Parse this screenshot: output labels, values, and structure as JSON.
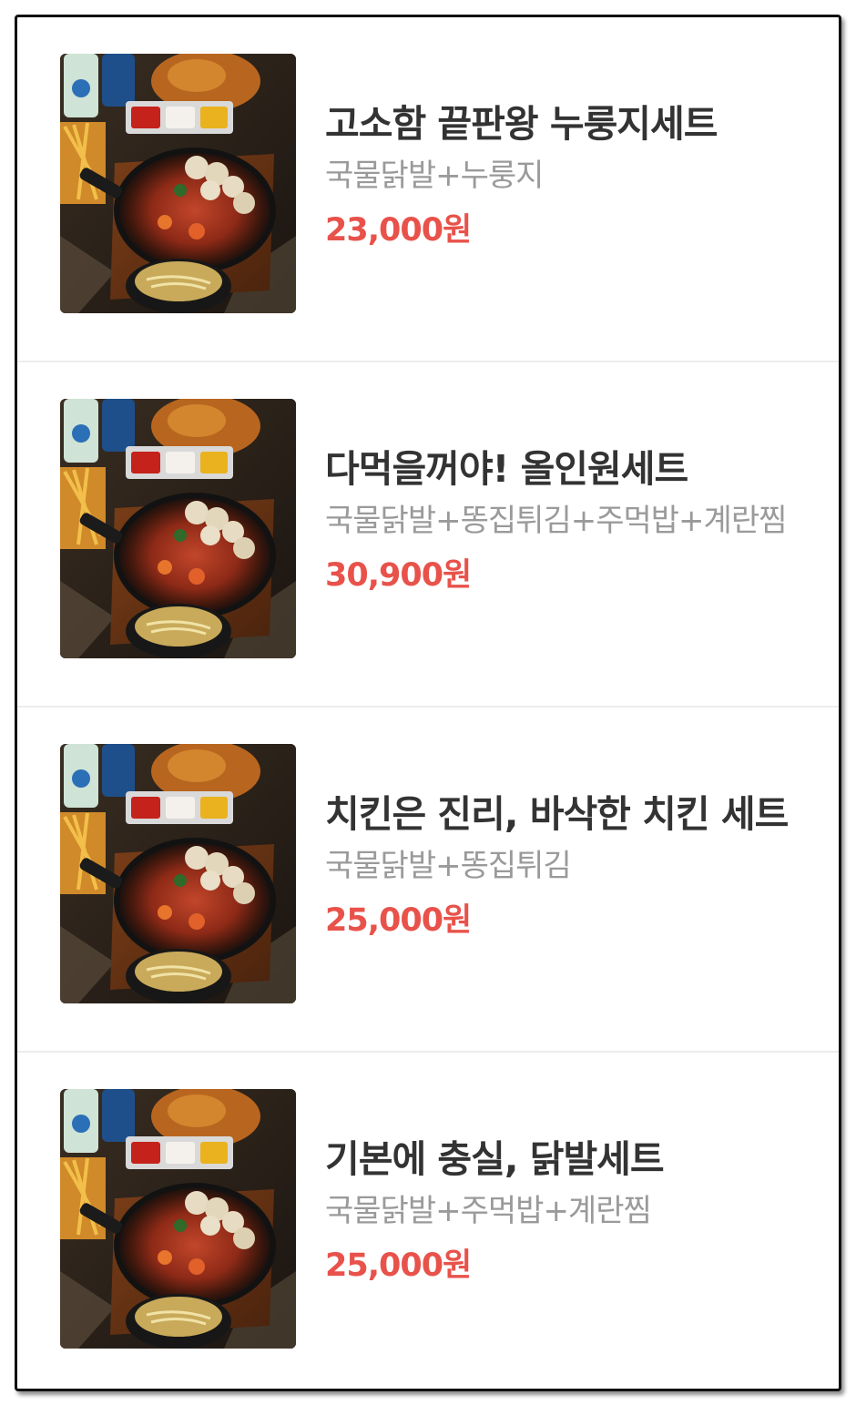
{
  "colors": {
    "name": "#333333",
    "description": "#9a9a9a",
    "price": "#e8524a",
    "divider": "#ececec",
    "border": "#111111"
  },
  "menu": {
    "items": [
      {
        "name": "고소함 끝판왕 누룽지세트",
        "description": "국물닭발+누룽지",
        "price": "23,000원",
        "image_icon": "food-photo-icon"
      },
      {
        "name": "다먹을꺼야! 올인원세트",
        "description": "국물닭발+똥집튀김+주먹밥+계란찜",
        "price": "30,900원",
        "image_icon": "food-photo-icon"
      },
      {
        "name": "치킨은 진리, 바삭한 치킨 세트",
        "description": "국물닭발+똥집튀김",
        "price": "25,000원",
        "image_icon": "food-photo-icon"
      },
      {
        "name": "기본에 충실, 닭발세트",
        "description": "국물닭발+주먹밥+계란찜",
        "price": "25,000원",
        "image_icon": "food-photo-icon"
      }
    ]
  }
}
